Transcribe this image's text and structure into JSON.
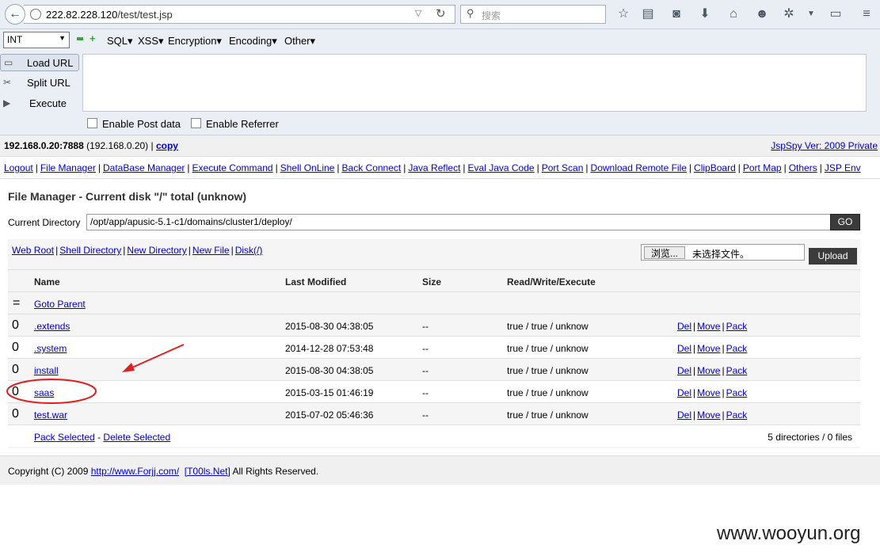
{
  "browser": {
    "url_host": "222.82.228.120",
    "url_path": "/test/test.jsp",
    "search_placeholder": "搜索"
  },
  "hackbar": {
    "select_value": "INT",
    "menus": [
      "SQL",
      "XSS",
      "Encryption",
      "Encoding",
      "Other"
    ],
    "load_url": "Load URL",
    "split_url": "Split URL",
    "execute": "Execute",
    "enable_post": "Enable Post data",
    "enable_referrer": "Enable Referrer"
  },
  "info": {
    "host": "192.168.0.20:7888",
    "ip": "(192.168.0.20)",
    "copy": "copy",
    "version": "JspSpy Ver: 2009 Private"
  },
  "nav": [
    "Logout",
    "File Manager",
    "DataBase Manager",
    "Execute Command",
    "Shell OnLine",
    "Back Connect",
    "Java Reflect",
    "Eval Java Code",
    "Port Scan",
    "Download Remote File",
    "ClipBoard",
    "Port Map",
    "Others",
    "JSP Env"
  ],
  "file_manager": {
    "title": "File Manager - Current disk \"/\" total (unknow)",
    "current_dir_label": "Current Directory",
    "current_dir": "/opt/app/apusic-5.1-c1/domains/cluster1/deploy/",
    "go": "GO",
    "links": [
      "Web Root",
      "Shell Directory",
      "New Directory",
      "New File",
      "Disk(/)"
    ],
    "browse": "浏览...",
    "no_file": "未选择文件。",
    "upload": "Upload",
    "headers": {
      "name": "Name",
      "modified": "Last Modified",
      "size": "Size",
      "rwx": "Read/Write/Execute"
    },
    "parent": {
      "glyph": "=",
      "label": "Goto Parent"
    },
    "rows": [
      {
        "glyph": "0",
        "name": ".extends",
        "modified": "2015-08-30 04:38:05",
        "size": "--",
        "rwx": "true / true / unknow"
      },
      {
        "glyph": "0",
        "name": ".system",
        "modified": "2014-12-28 07:53:48",
        "size": "--",
        "rwx": "true / true / unknow"
      },
      {
        "glyph": "0",
        "name": "install",
        "modified": "2015-08-30 04:38:05",
        "size": "--",
        "rwx": "true / true / unknow"
      },
      {
        "glyph": "0",
        "name": "saas",
        "modified": "2015-03-15 01:46:19",
        "size": "--",
        "rwx": "true / true / unknow"
      },
      {
        "glyph": "0",
        "name": "test.war",
        "modified": "2015-07-02 05:46:36",
        "size": "--",
        "rwx": "true / true / unknow"
      }
    ],
    "row_actions": {
      "del": "Del",
      "move": "Move",
      "pack": "Pack"
    },
    "pack_selected": "Pack Selected",
    "dash": "-",
    "delete_selected": "Delete Selected",
    "summary": "5 directories / 0 files"
  },
  "footer": {
    "prefix": "Copyright (C) 2009",
    "link1": "http://www.Forjj.com/",
    "link2": "[T00ls.Net]",
    "suffix": "All Rights Reserved."
  },
  "watermark": "www.wooyun.org",
  "colors": {
    "link": "#0000cc",
    "annotation": "#e02020",
    "button_dark": "#3b3b3b"
  }
}
